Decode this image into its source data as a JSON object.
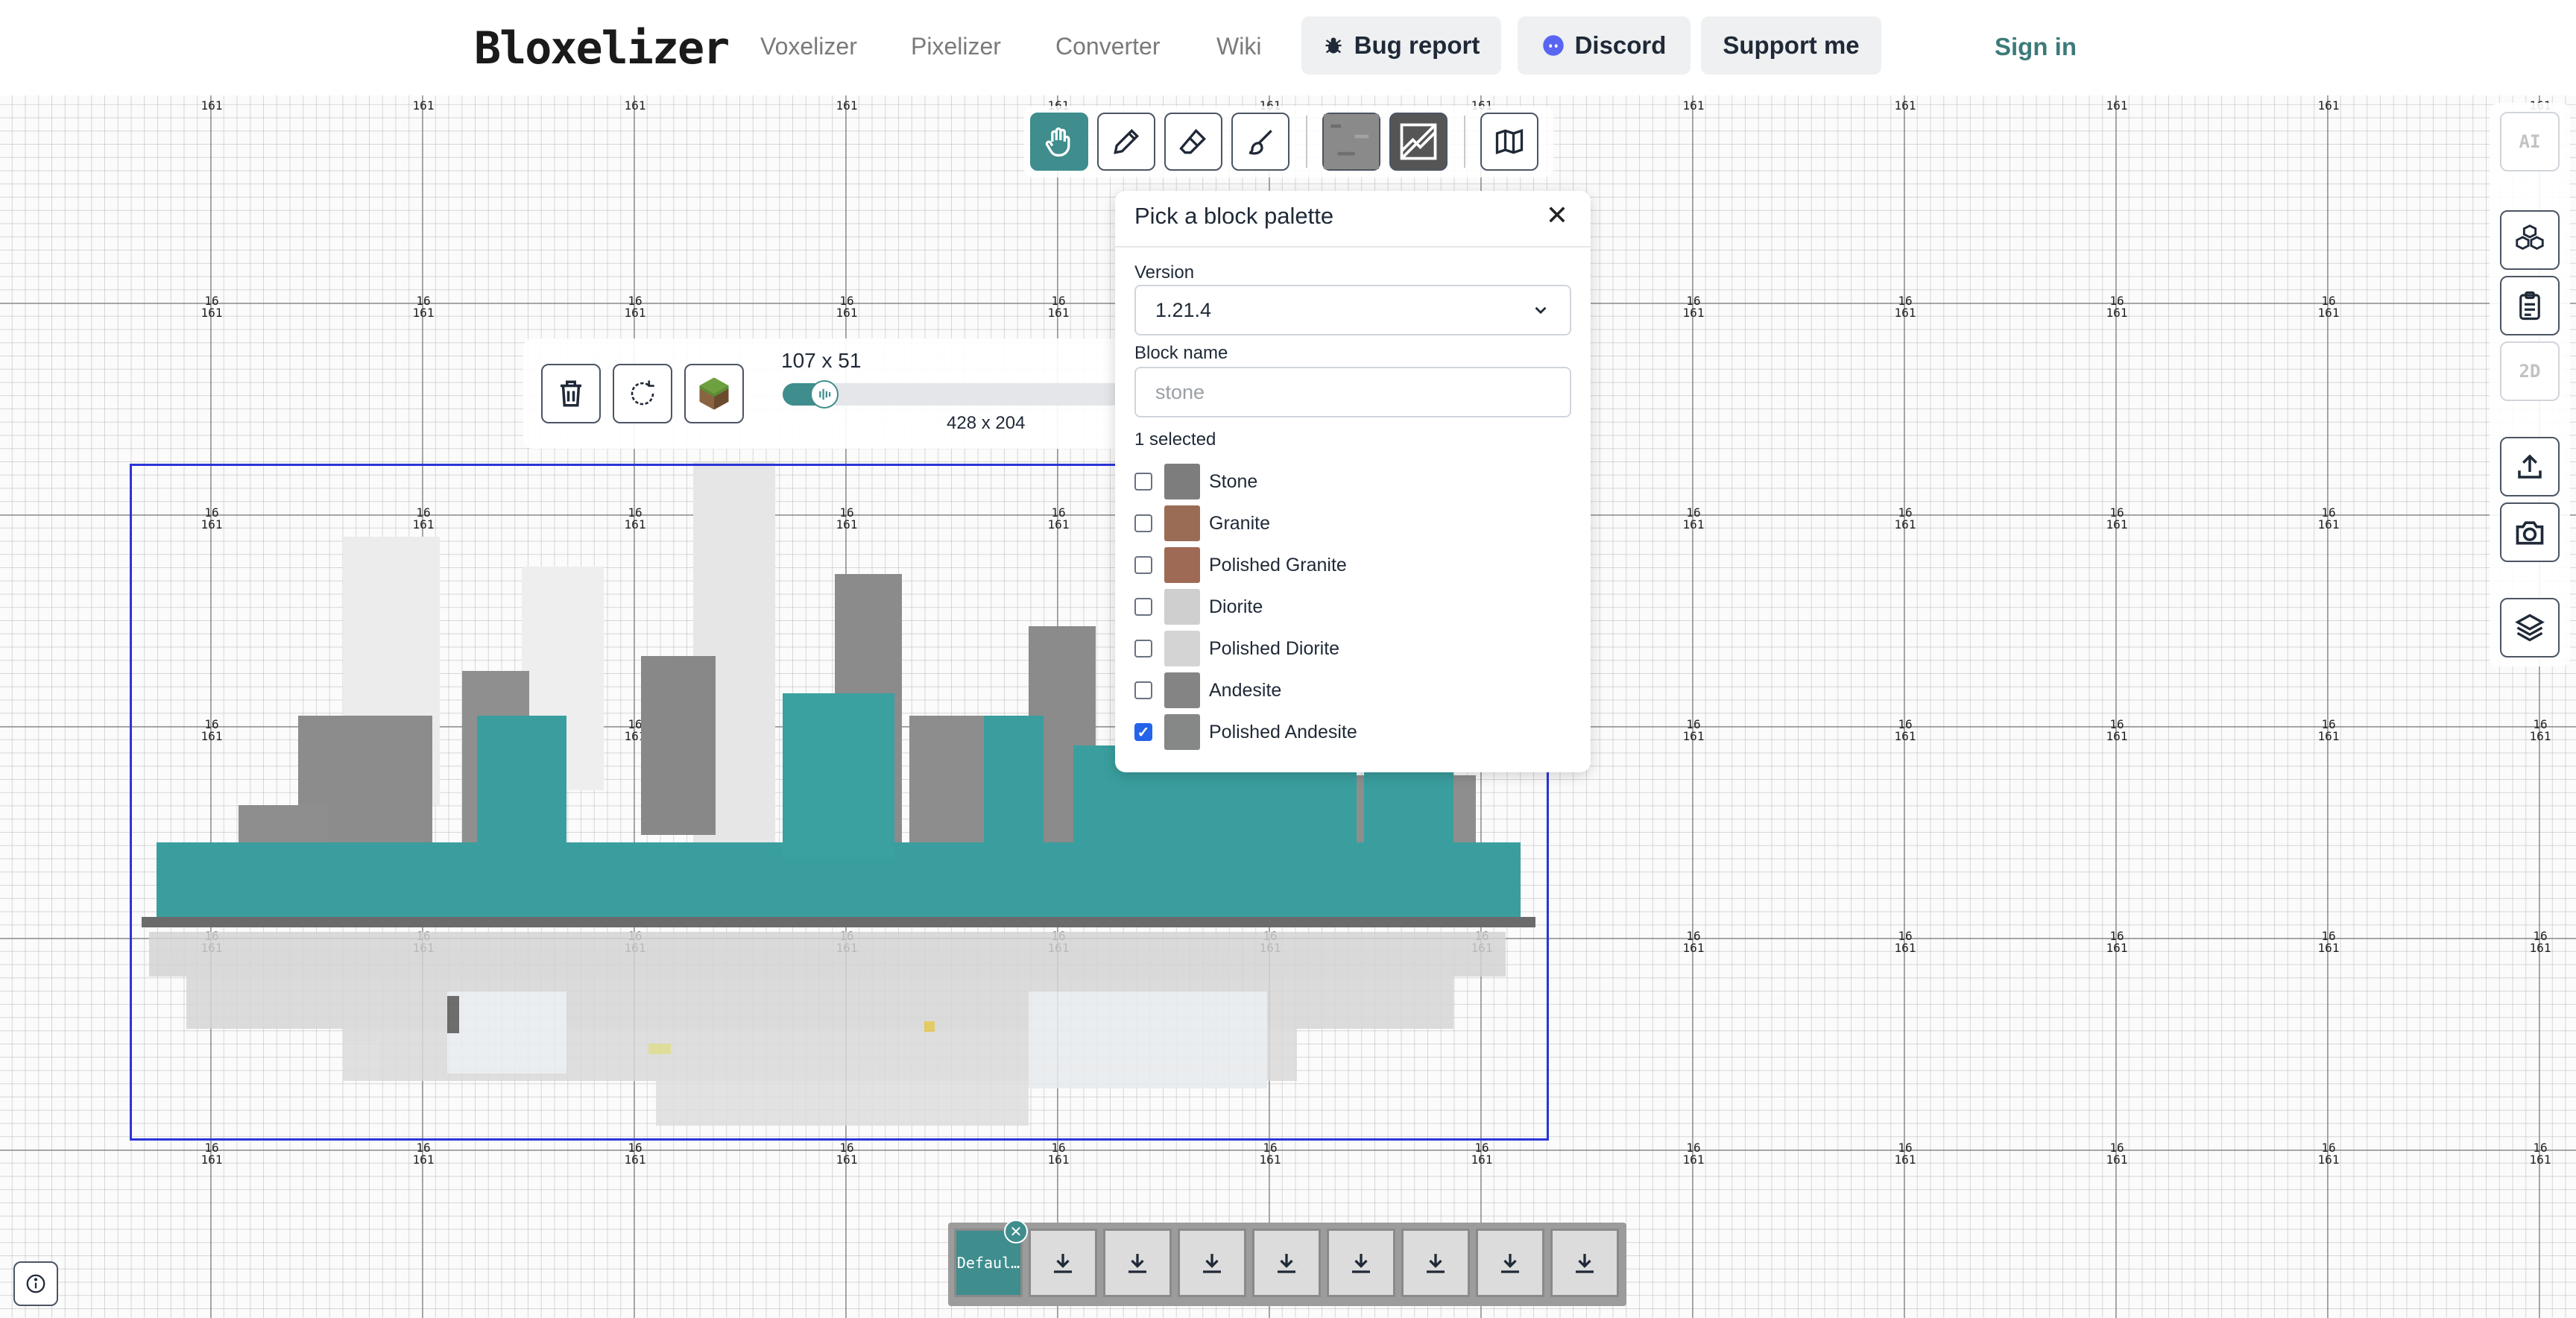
{
  "header": {
    "logo": "Bloxelizer",
    "nav": [
      "Voxelizer",
      "Pixelizer",
      "Converter",
      "Wiki"
    ],
    "bug_report": "Bug report",
    "discord": "Discord",
    "support": "Support me",
    "sign_in": "Sign in"
  },
  "grid": {
    "chunk_label_top": "16",
    "chunk_label_bottom": "161"
  },
  "toolbar": {
    "tools": [
      "hand-icon",
      "pencil-icon",
      "eraser-icon",
      "brush-icon",
      "stone-texture",
      "dark-texture",
      "map-icon"
    ],
    "active": "hand-icon"
  },
  "rail": {
    "ai_label": "AI",
    "label_2d": "2D",
    "icons": [
      "cubes-icon",
      "clipboard-icon",
      "upload-icon",
      "camera-icon",
      "layers-icon"
    ]
  },
  "build": {
    "dimensions": "107 x 51",
    "output_dimensions": "428 x 204",
    "scale_fraction": 0.08
  },
  "palette": {
    "title": "Pick a block palette",
    "version_label": "Version",
    "version_value": "1.21.4",
    "block_name_label": "Block name",
    "block_name_placeholder": "stone",
    "selected_count": "1 selected",
    "items": [
      {
        "label": "Stone",
        "checked": false,
        "color": "#7d7d7d"
      },
      {
        "label": "Granite",
        "checked": false,
        "color": "#9a6c55"
      },
      {
        "label": "Polished Granite",
        "checked": false,
        "color": "#9e6a55"
      },
      {
        "label": "Diorite",
        "checked": false,
        "color": "#cfcfcf"
      },
      {
        "label": "Polished Diorite",
        "checked": false,
        "color": "#d4d4d4"
      },
      {
        "label": "Andesite",
        "checked": false,
        "color": "#848484"
      },
      {
        "label": "Polished Andesite",
        "checked": true,
        "color": "#868888"
      }
    ]
  },
  "slots": {
    "first_label": "Defaul…",
    "count": 8
  },
  "colors": {
    "accent": "#3f8d8d",
    "teal_block": "#3a9e9e",
    "selection_border": "#2b35d8"
  }
}
